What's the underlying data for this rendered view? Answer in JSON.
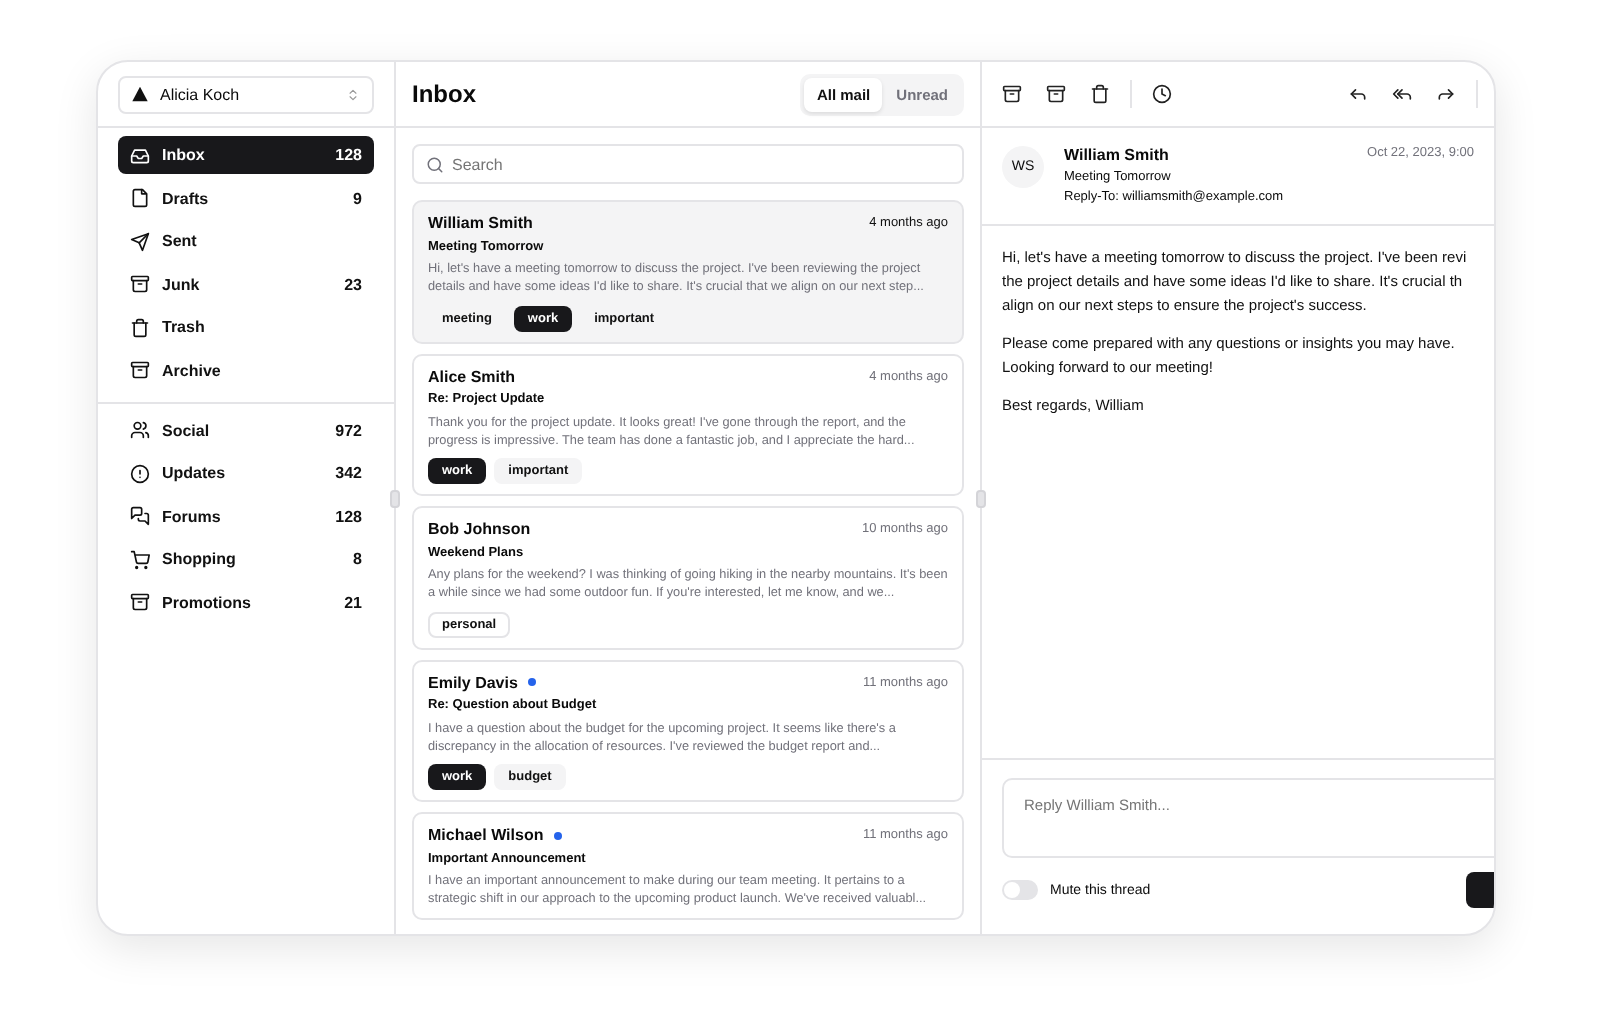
{
  "account": {
    "name": "Alicia Koch"
  },
  "nav_primary": [
    {
      "kind": "inbox",
      "label": "Inbox",
      "count": "128",
      "selected": true
    },
    {
      "kind": "drafts",
      "label": "Drafts",
      "count": "9",
      "selected": false
    },
    {
      "kind": "sent",
      "label": "Sent",
      "selected": false
    },
    {
      "kind": "junk",
      "label": "Junk",
      "count": "23",
      "selected": false
    },
    {
      "kind": "trash",
      "label": "Trash",
      "selected": false
    },
    {
      "kind": "archive",
      "label": "Archive",
      "selected": false
    }
  ],
  "nav_secondary": [
    {
      "kind": "social",
      "label": "Social",
      "count": "972",
      "selected": false
    },
    {
      "kind": "updates",
      "label": "Updates",
      "count": "342",
      "selected": false
    },
    {
      "kind": "forums",
      "label": "Forums",
      "count": "128",
      "selected": false
    },
    {
      "kind": "shopping",
      "label": "Shopping",
      "count": "8",
      "selected": false
    },
    {
      "kind": "promotions",
      "label": "Promotions",
      "count": "21",
      "selected": false
    }
  ],
  "mail_list": {
    "title": "Inbox",
    "filters": [
      {
        "label": "All mail",
        "selected": true
      },
      {
        "label": "Unread",
        "selected": false
      }
    ],
    "search": {
      "placeholder": "Search"
    },
    "mails": [
      {
        "sender": "William Smith",
        "unread": false,
        "selected": true,
        "time": "4 months ago",
        "subject": "Meeting Tomorrow",
        "preview": "Hi, let's have a meeting tomorrow to discuss the project. I've been reviewing the project details and have some ideas I'd like to share. It's crucial that we align on our next step...",
        "tags": [
          {
            "label": "meeting",
            "kind": "secondary"
          },
          {
            "label": "work",
            "kind": "primary"
          },
          {
            "label": "important",
            "kind": "secondary"
          }
        ]
      },
      {
        "sender": "Alice Smith",
        "unread": false,
        "selected": false,
        "time": "4 months ago",
        "subject": "Re: Project Update",
        "preview": "Thank you for the project update. It looks great! I've gone through the report, and the progress is impressive. The team has done a fantastic job, and I appreciate the hard...",
        "tags": [
          {
            "label": "work",
            "kind": "primary"
          },
          {
            "label": "important",
            "kind": "secondary"
          }
        ]
      },
      {
        "sender": "Bob Johnson",
        "unread": false,
        "selected": false,
        "time": "10 months ago",
        "subject": "Weekend Plans",
        "preview": "Any plans for the weekend? I was thinking of going hiking in the nearby mountains. It's been a while since we had some outdoor fun. If you're interested, let me know, and we...",
        "tags": [
          {
            "label": "personal",
            "kind": "outline"
          }
        ]
      },
      {
        "sender": "Emily Davis",
        "unread": true,
        "selected": false,
        "time": "11 months ago",
        "subject": "Re: Question about Budget",
        "preview": "I have a question about the budget for the upcoming project. It seems like there's a discrepancy in the allocation of resources. I've reviewed the budget report and...",
        "tags": [
          {
            "label": "work",
            "kind": "primary"
          },
          {
            "label": "budget",
            "kind": "secondary"
          }
        ]
      },
      {
        "sender": "Michael Wilson",
        "unread": true,
        "selected": false,
        "time": "11 months ago",
        "subject": "Important Announcement",
        "preview": "I have an important announcement to make during our team meeting. It pertains to a strategic shift in our approach to the upcoming product launch. We've received valuabl..."
      }
    ]
  },
  "detail": {
    "avatar": "WS",
    "sender": "William Smith",
    "subject": "Meeting Tomorrow",
    "reply_to": "Reply-To: williamsmith@example.com",
    "date": "Oct 22, 2023, 9:00",
    "body": [
      [
        "Hi, let's have a meeting tomorrow to discuss the project. I've been revi",
        "the project details and have some ideas I'd like to share. It's crucial th",
        "align on our next steps to ensure the project's success."
      ],
      [
        "Please come prepared with any questions or insights you may have.",
        "Looking forward to our meeting!"
      ],
      [
        "Best regards, William"
      ]
    ],
    "reply": {
      "placeholder": "Reply William Smith..."
    },
    "mute": {
      "label": "Mute this thread",
      "on": false
    }
  }
}
